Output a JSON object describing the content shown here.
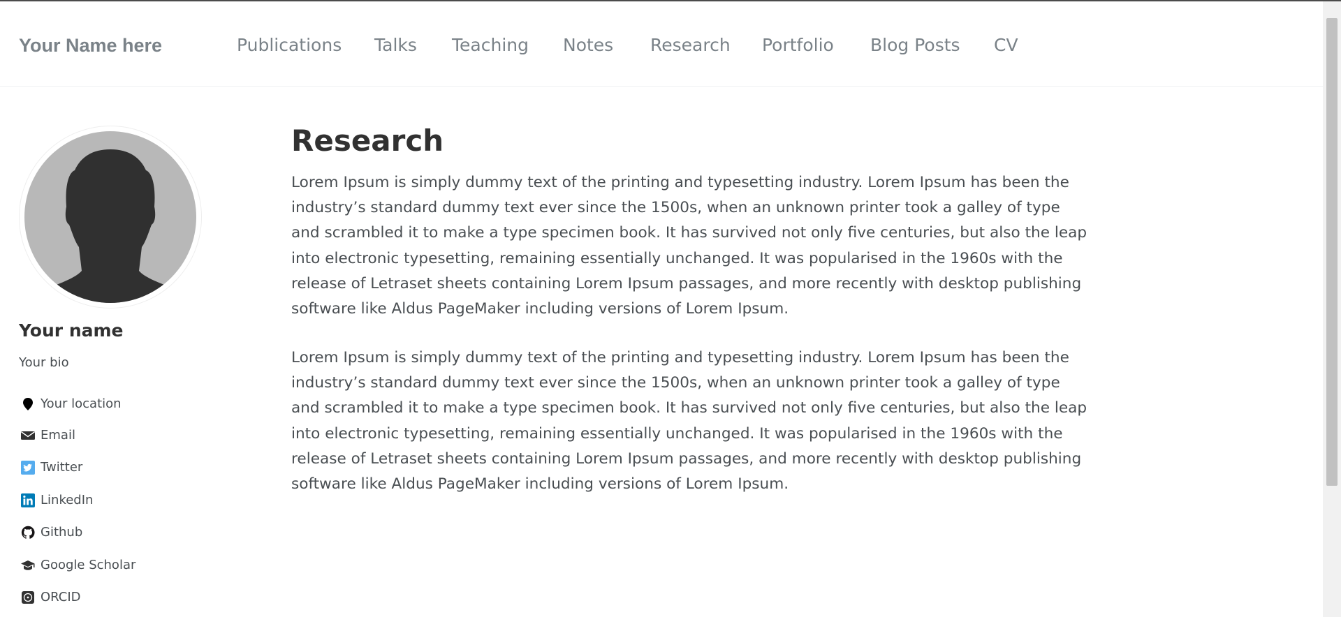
{
  "site": {
    "title": "Your Name here"
  },
  "nav": {
    "items": [
      {
        "label": "Publications"
      },
      {
        "label": "Talks"
      },
      {
        "label": "Teaching"
      },
      {
        "label": "Notes"
      },
      {
        "label": "Research"
      },
      {
        "label": "Portfolio"
      },
      {
        "label": "Blog Posts"
      },
      {
        "label": "CV"
      }
    ]
  },
  "author": {
    "name": "Your name",
    "bio": "Your bio",
    "links": [
      {
        "label": "Your location",
        "icon": "map-marker-icon",
        "color": "#000000"
      },
      {
        "label": "Email",
        "icon": "envelope-icon",
        "color": "#313131"
      },
      {
        "label": "Twitter",
        "icon": "twitter-icon",
        "color": "#55acee"
      },
      {
        "label": "LinkedIn",
        "icon": "linkedin-icon",
        "color": "#007bb6"
      },
      {
        "label": "Github",
        "icon": "github-icon",
        "color": "#171516"
      },
      {
        "label": "Google Scholar",
        "icon": "graduation-cap-icon",
        "color": "#313131"
      },
      {
        "label": "ORCID",
        "icon": "orcid-icon",
        "color": "#313131"
      }
    ]
  },
  "page": {
    "title": "Research",
    "paragraphs": [
      "Lorem Ipsum is simply dummy text of the printing and typesetting industry. Lorem Ipsum has been the industry’s standard dummy text ever since the 1500s, when an unknown printer took a galley of type and scrambled it to make a type specimen book. It has survived not only five centuries, but also the leap into electronic typesetting, remaining essentially unchanged. It was popularised in the 1960s with the release of Letraset sheets containing Lorem Ipsum passages, and more recently with desktop publishing software like Aldus PageMaker including versions of Lorem Ipsum.",
      "Lorem Ipsum is simply dummy text of the printing and typesetting industry. Lorem Ipsum has been the industry’s standard dummy text ever since the 1500s, when an unknown printer took a galley of type and scrambled it to make a type specimen book. It has survived not only five centuries, but also the leap into electronic typesetting, remaining essentially unchanged. It was popularised in the 1960s with the release of Letraset sheets containing Lorem Ipsum passages, and more recently with desktop publishing software like Aldus PageMaker including versions of Lorem Ipsum."
    ]
  },
  "theme": {
    "text": "#494e52",
    "heading": "#313131",
    "nav": "#7a8288"
  }
}
